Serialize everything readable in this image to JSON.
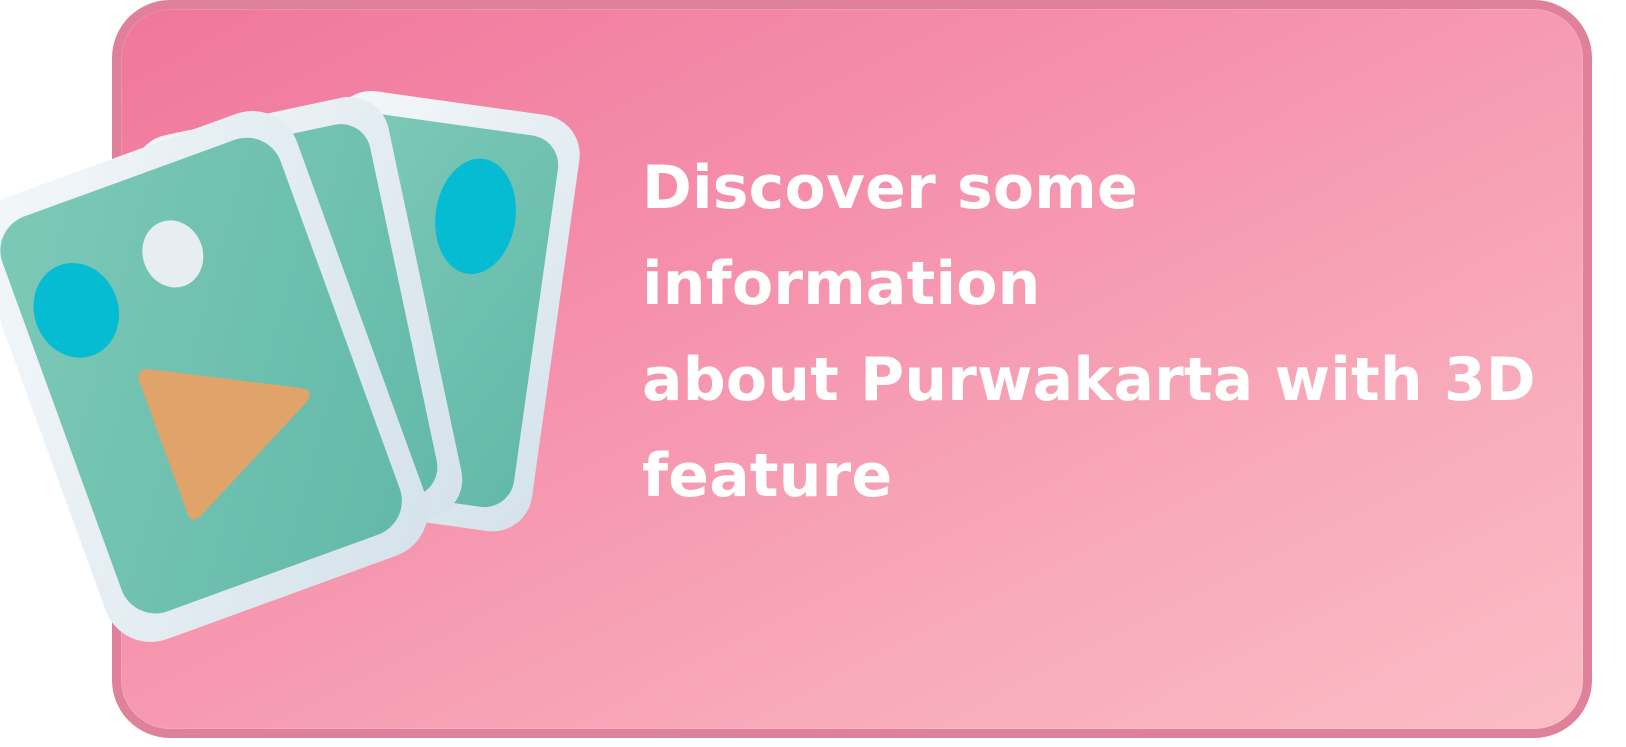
{
  "card": {
    "headline": "Discover some information\nabout Purwakarta with 3D\nfeature"
  },
  "illustration": {
    "icon": "photo-gallery-3d-icon"
  },
  "colors": {
    "gradient_start": "#f0779c",
    "gradient_end": "#fbbdc6",
    "border": "#e0819c",
    "text": "#ffffff",
    "frame": "#e6eef2",
    "photo_green": "#6fc2b0",
    "circle_blue": "#06bcd2",
    "triangle_orange": "#e0a36a",
    "accent_red": "#c0124a"
  }
}
